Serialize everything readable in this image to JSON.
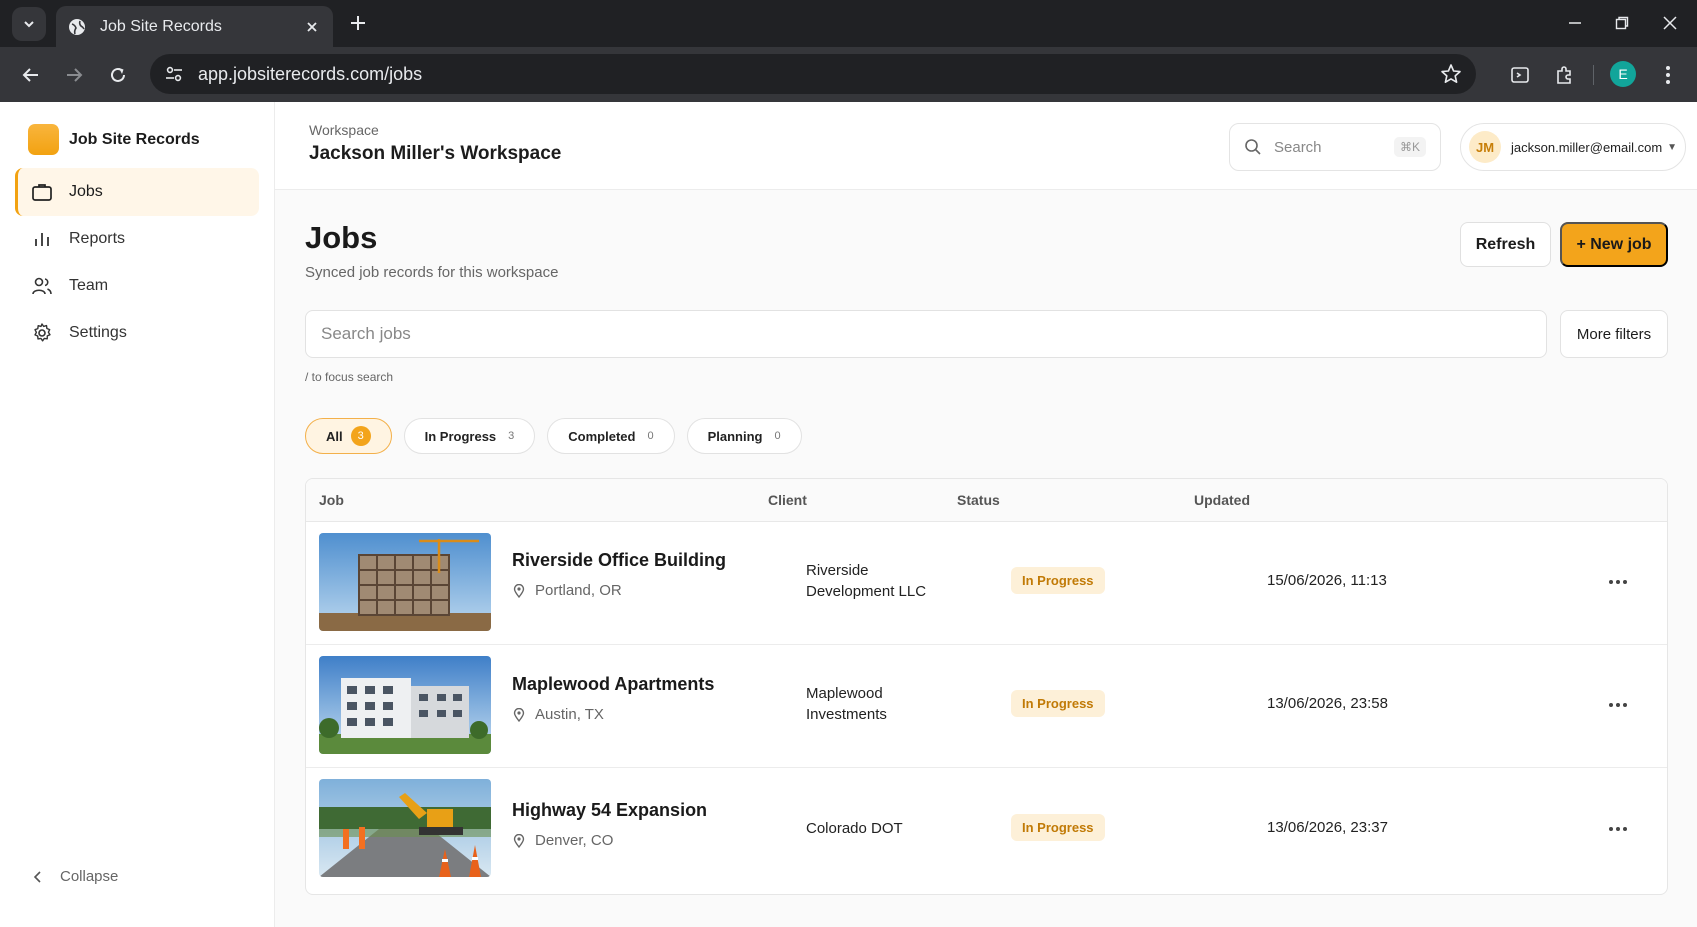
{
  "browser": {
    "tab_title": "Job Site Records",
    "url": "app.jobsiterecords.com/jobs",
    "profile_initial": "E"
  },
  "sidebar": {
    "brand": "Job Site Records",
    "items": [
      {
        "label": "Jobs",
        "icon": "briefcase-icon",
        "active": true
      },
      {
        "label": "Reports",
        "icon": "bar-chart-icon",
        "active": false
      },
      {
        "label": "Team",
        "icon": "users-icon",
        "active": false
      },
      {
        "label": "Settings",
        "icon": "gear-icon",
        "active": false
      }
    ],
    "collapse_label": "Collapse"
  },
  "header": {
    "workspace_label": "Workspace",
    "workspace_name": "Jackson Miller's Workspace",
    "search_placeholder": "Search",
    "search_shortcut": "⌘K",
    "user_initials": "JM",
    "user_email": "jackson.miller@email.com"
  },
  "page": {
    "title": "Jobs",
    "subtitle": "Synced job records for this workspace",
    "refresh_label": "Refresh",
    "new_job_label": "+ New job",
    "search_placeholder": "Search jobs",
    "more_filters_label": "More filters",
    "search_hint": "/ to focus search"
  },
  "filters": [
    {
      "label": "All",
      "count": "3",
      "active": true
    },
    {
      "label": "In Progress",
      "count": "3",
      "active": false
    },
    {
      "label": "Completed",
      "count": "0",
      "active": false
    },
    {
      "label": "Planning",
      "count": "0",
      "active": false
    }
  ],
  "table": {
    "columns": [
      "Job",
      "Client",
      "Status",
      "Updated"
    ],
    "rows": [
      {
        "name": "Riverside Office Building",
        "location": "Portland, OR",
        "client_line1": "Riverside",
        "client_line2": "Development LLC",
        "status": "In Progress",
        "updated": "15/06/2026, 11:13"
      },
      {
        "name": "Maplewood Apartments",
        "location": "Austin, TX",
        "client_line1": "Maplewood",
        "client_line2": "Investments",
        "status": "In Progress",
        "updated": "13/06/2026, 23:58"
      },
      {
        "name": "Highway 54 Expansion",
        "location": "Denver, CO",
        "client_line1": "Colorado DOT",
        "client_line2": "",
        "status": "In Progress",
        "updated": "13/06/2026, 23:37"
      }
    ]
  },
  "colors": {
    "accent": "#f3a41b",
    "status_bg": "#fdf0d8",
    "status_text": "#c17a06"
  }
}
